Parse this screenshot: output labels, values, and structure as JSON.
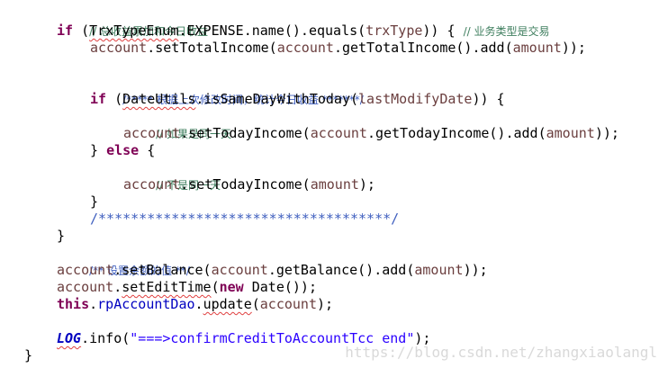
{
  "code": {
    "l1_comment": "// 总收益累加和今日收益",
    "l2_if": "if",
    "l2_open": " (",
    "l2_class": "TrxTypeEnum",
    "l2_mid": ".EXPENSE.name().equals(",
    "l2_param": "trxType",
    "l2_close": ")) {",
    "l2_comment": "// 业务类型是交易",
    "l3_var": "account",
    "l3_call": ".setTotalIncome(",
    "l3_var2": "account",
    "l3_rest": ".getTotalIncome().add(",
    "l3_param": "amount",
    "l3_end": "));",
    "l5_comment": "/***** 根据上次修改时间，统计今日收益 *******/",
    "l6_if": "if",
    "l6_open": " (",
    "l6_class": "DateUtils",
    "l6_mid": ".isSameDayWithToday(",
    "l6_param": "lastModifyDate",
    "l6_close": ")) {",
    "l7_comment": "// 如果是同一天",
    "l8_var": "account",
    "l8_call": ".setTodayIncome(",
    "l8_var2": "account",
    "l8_rest": ".getTodayIncome().add(",
    "l8_param": "amount",
    "l8_end": "));",
    "l9_brace": "} ",
    "l9_else": "else",
    "l9_open": " {",
    "l10_comment": "// 不是同一天",
    "l11_var": "account",
    "l11_call": ".setTodayIncome(",
    "l11_param": "amount",
    "l11_end": ");",
    "l12_brace": "}",
    "l13_comment": "/************************************/",
    "l14_brace": "}",
    "l15_comment": "/** 设置余额的值 **/",
    "l16_var": "account",
    "l16_call": ".setBalance(",
    "l16_var2": "account",
    "l16_rest": ".getBalance().add(",
    "l16_param": "amount",
    "l16_end": "));",
    "l17_var": "account",
    "l17_dot": ".",
    "l17_method": "setEditTime",
    "l17_open": "(",
    "l17_new": "new",
    "l17_end": " Date());",
    "l18_this": "this",
    "l18_dot": ".",
    "l18_field": "rpAccountDao",
    "l18_dot2": ".",
    "l18_method": "update",
    "l18_open": "(",
    "l18_var": "account",
    "l18_end": ");",
    "l20_log": "LOG",
    "l20_call": ".info(",
    "l20_string": "\"===>confirmCreditToAccountTcc end\"",
    "l20_end": ");",
    "l21_brace": "}"
  },
  "watermark": "https://blog.csdn.net/zhangxiaolangl"
}
